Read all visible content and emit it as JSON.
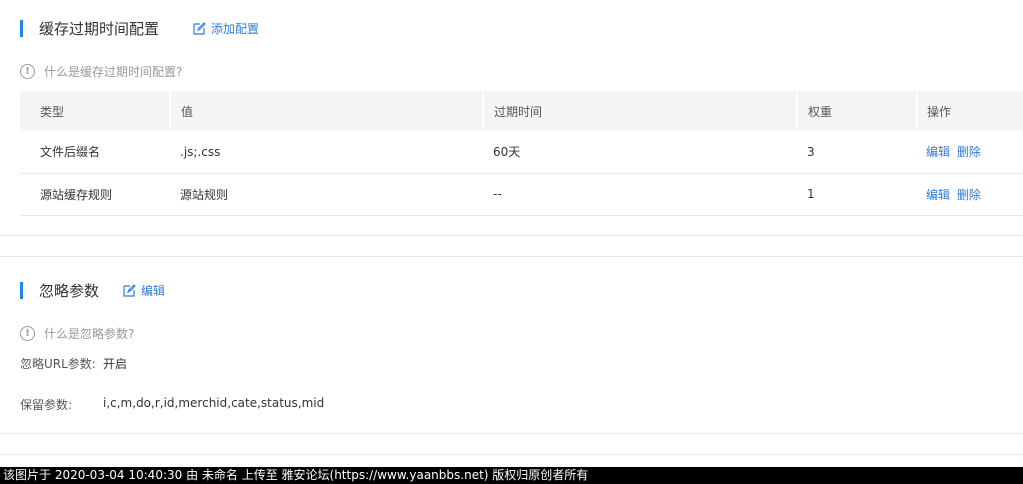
{
  "cache_section": {
    "title": "缓存过期时间配置",
    "action_label": "添加配置",
    "help_text": "什么是缓存过期时间配置?",
    "table": {
      "headers": [
        "类型",
        "值",
        "过期时间",
        "权重",
        "操作"
      ],
      "rows": [
        {
          "type": "文件后缀名",
          "value": ".js;.css",
          "expire": "60天",
          "weight": "3",
          "edit": "编辑",
          "delete": "删除"
        },
        {
          "type": "源站缓存规则",
          "value": "源站规则",
          "expire": "--",
          "weight": "1",
          "edit": "编辑",
          "delete": "删除"
        }
      ]
    }
  },
  "ignore_section": {
    "title": "忽略参数",
    "action_label": "编辑",
    "help_text": "什么是忽略参数?",
    "url_param_label": "忽略URL参数:",
    "url_param_value": "开启",
    "keep_param_label": "保留参数:",
    "keep_param_value": "i,c,m,do,r,id,merchid,cate,status,mid"
  },
  "watermark": "该图片于 2020-03-04 10:40:30 由 未命名 上传至 雅安论坛(https://www.yaanbbs.net) 版权归原创者所有",
  "colors": {
    "accent": "#1e88e5",
    "link": "#2f7bd7",
    "header_bg": "#f5f5f5"
  }
}
